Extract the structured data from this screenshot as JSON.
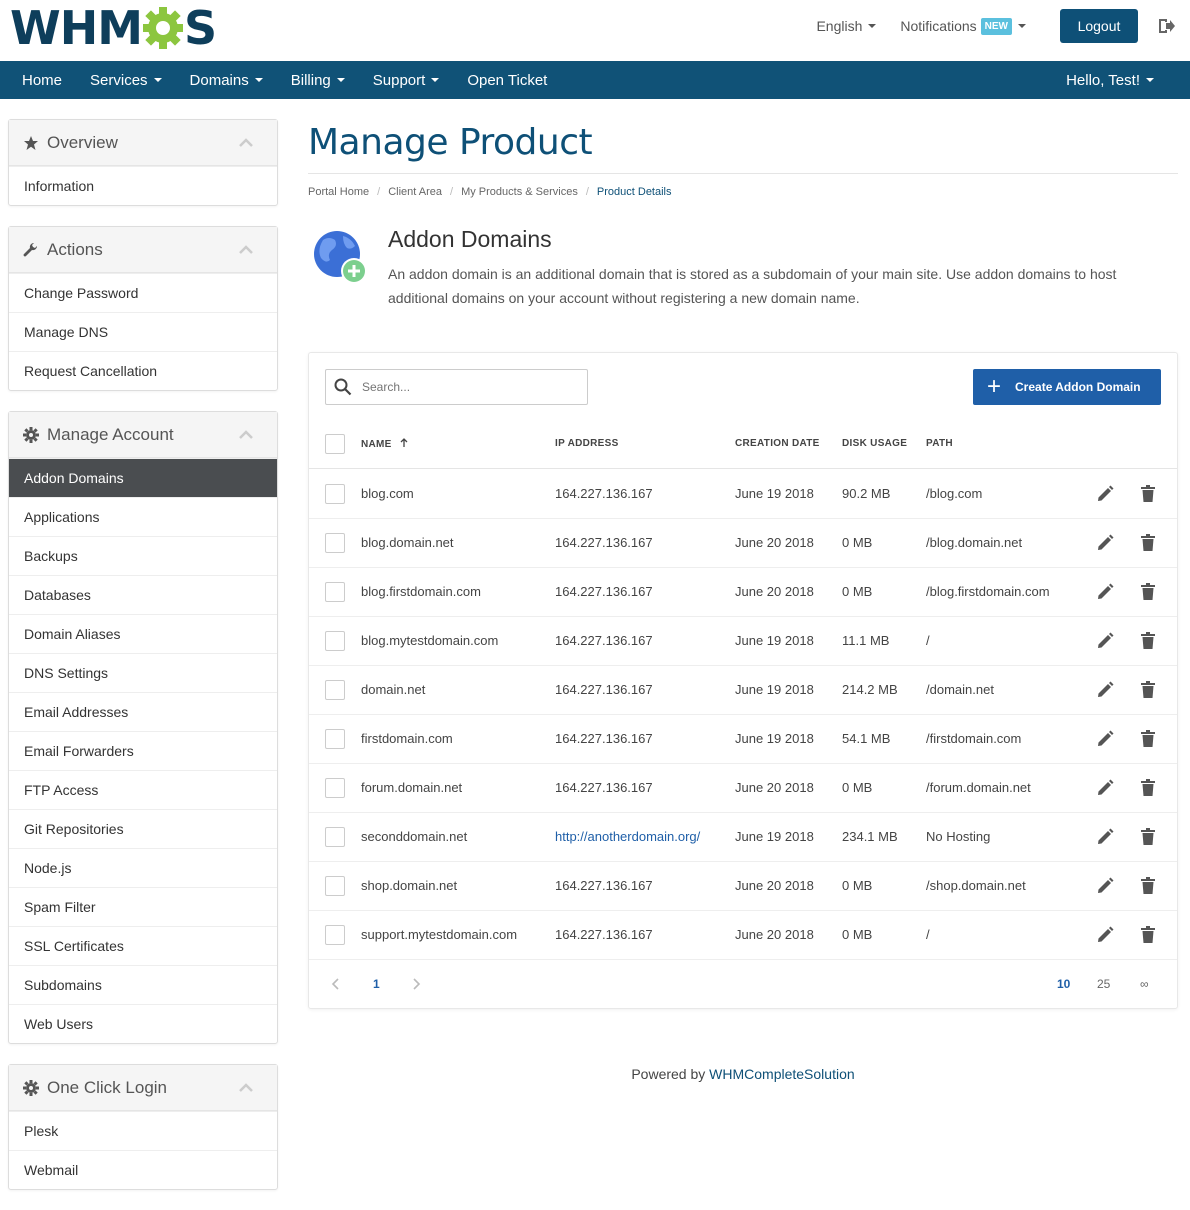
{
  "brand": {
    "logo_left": "WHM",
    "logo_right": "S",
    "primary_color": "#0e5077",
    "gear_color": "#8cc63f"
  },
  "top": {
    "language": "English",
    "notifications": "Notifications",
    "notifications_badge": "NEW",
    "logout": "Logout"
  },
  "nav": {
    "items": [
      "Home",
      "Services",
      "Domains",
      "Billing",
      "Support",
      "Open Ticket"
    ],
    "user": "Hello, Test!"
  },
  "sidebar": {
    "overview": {
      "title": "Overview",
      "items": [
        "Information"
      ]
    },
    "actions": {
      "title": "Actions",
      "items": [
        "Change Password",
        "Manage DNS",
        "Request Cancellation"
      ]
    },
    "manage": {
      "title": "Manage Account",
      "items": [
        "Addon Domains",
        "Applications",
        "Backups",
        "Databases",
        "Domain Aliases",
        "DNS Settings",
        "Email Addresses",
        "Email Forwarders",
        "FTP Access",
        "Git Repositories",
        "Node.js",
        "Spam Filter",
        "SSL Certificates",
        "Subdomains",
        "Web Users"
      ],
      "active": "Addon Domains"
    },
    "oneclick": {
      "title": "One Click Login",
      "items": [
        "Plesk",
        "Webmail"
      ]
    }
  },
  "main": {
    "title": "Manage Product",
    "breadcrumb": [
      "Portal Home",
      "Client Area",
      "My Products & Services",
      "Product Details"
    ],
    "section_title": "Addon Domains",
    "section_desc": "An addon domain is an additional domain that is stored as a subdomain of your main site. Use addon domains to host additional domains on your account without registering a new domain name."
  },
  "table": {
    "search_placeholder": "Search...",
    "create_button": "Create Addon Domain",
    "headers": {
      "name": "NAME",
      "ip": "IP ADDRESS",
      "date": "CREATION DATE",
      "disk": "DISK USAGE",
      "path": "PATH"
    },
    "rows": [
      {
        "name": "blog.com",
        "ip": "164.227.136.167",
        "date": "June 19 2018",
        "disk": "90.2 MB",
        "path": "/blog.com"
      },
      {
        "name": "blog.domain.net",
        "ip": "164.227.136.167",
        "date": "June 20 2018",
        "disk": "0 MB",
        "path": "/blog.domain.net"
      },
      {
        "name": "blog.firstdomain.com",
        "ip": "164.227.136.167",
        "date": "June 20 2018",
        "disk": "0 MB",
        "path": "/blog.firstdomain.com"
      },
      {
        "name": "blog.mytestdomain.com",
        "ip": "164.227.136.167",
        "date": "June 19 2018",
        "disk": "11.1 MB",
        "path": "/"
      },
      {
        "name": "domain.net",
        "ip": "164.227.136.167",
        "date": "June 19 2018",
        "disk": "214.2 MB",
        "path": "/domain.net"
      },
      {
        "name": "firstdomain.com",
        "ip": "164.227.136.167",
        "date": "June 19 2018",
        "disk": "54.1 MB",
        "path": "/firstdomain.com"
      },
      {
        "name": "forum.domain.net",
        "ip": "164.227.136.167",
        "date": "June 20 2018",
        "disk": "0 MB",
        "path": "/forum.domain.net"
      },
      {
        "name": "seconddomain.net",
        "ip": "http://anotherdomain.org/",
        "ip_is_link": true,
        "date": "June 19 2018",
        "disk": "234.1 MB",
        "path": "No Hosting"
      },
      {
        "name": "shop.domain.net",
        "ip": "164.227.136.167",
        "date": "June 20 2018",
        "disk": "0 MB",
        "path": "/shop.domain.net"
      },
      {
        "name": "support.mytestdomain.com",
        "ip": "164.227.136.167",
        "date": "June 20 2018",
        "disk": "0 MB",
        "path": "/"
      }
    ],
    "pagination": {
      "current": "1",
      "page_sizes": [
        "10",
        "25",
        "∞"
      ],
      "active_size": "10"
    }
  },
  "footer": {
    "prefix": "Powered by",
    "link": "WHMCompleteSolution"
  }
}
